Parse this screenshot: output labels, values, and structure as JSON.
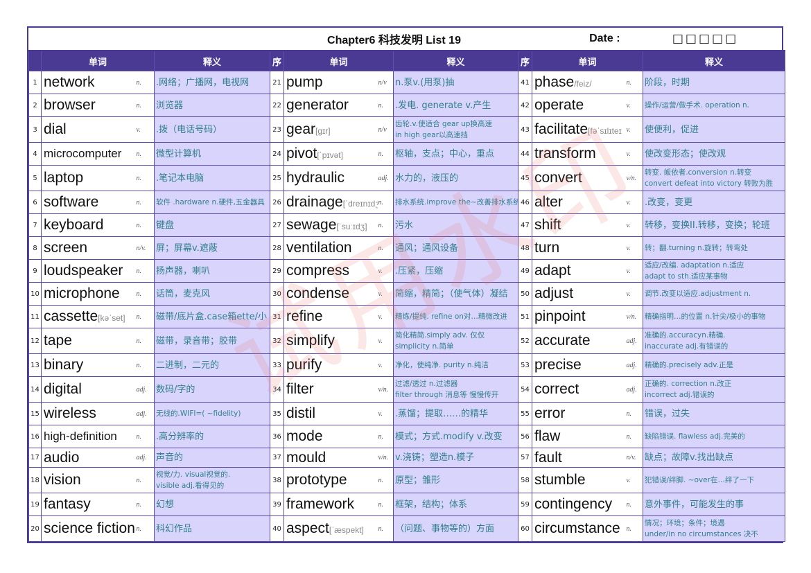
{
  "title": "Chapter6 科技发明 List 19",
  "date_label": "Date :",
  "date_boxes": "□□□□□",
  "headers": {
    "num": "序",
    "word": "单词",
    "meaning": "释义"
  },
  "watermark": "试用水印",
  "columns": [
    {
      "rows": [
        {
          "n": "1",
          "word": "network",
          "phon": "",
          "pos": "n.",
          "meaning": ".网络；广播网，电视网"
        },
        {
          "n": "2",
          "word": "browser",
          "phon": "",
          "pos": "n.",
          "meaning": "浏览器"
        },
        {
          "n": "3",
          "word": "dial",
          "phon": "",
          "pos": "v.",
          "meaning": ".拨（电话号码）"
        },
        {
          "n": "4",
          "word": "microcomputer",
          "phon": "",
          "pos": "n.",
          "meaning": "微型计算机"
        },
        {
          "n": "5",
          "word": "laptop",
          "phon": "",
          "pos": "n.",
          "meaning": ".笔记本电脑"
        },
        {
          "n": "6",
          "word": "software",
          "phon": "",
          "pos": "n.",
          "meaning": "软件 .hardware n.硬件,五金器具"
        },
        {
          "n": "7",
          "word": "keyboard",
          "phon": "",
          "pos": "n.",
          "meaning": "键盘"
        },
        {
          "n": "8",
          "word": "screen",
          "phon": "",
          "pos": "n/v.",
          "meaning": "屏；屏幕v.遮蔽"
        },
        {
          "n": "9",
          "word": "loudspeaker",
          "phon": "",
          "pos": "n.",
          "meaning": "扬声器，喇叭"
        },
        {
          "n": "10",
          "word": "microphone",
          "phon": "",
          "pos": "n.",
          "meaning": "话筒，麦克风"
        },
        {
          "n": "11",
          "word": "cassette",
          "phon": "[kəˈset]",
          "pos": "n.",
          "meaning": "磁带/底片盒.case箱ette/小"
        },
        {
          "n": "12",
          "word": "tape",
          "phon": "",
          "pos": "n.",
          "meaning": "磁带，录音带；胶带"
        },
        {
          "n": "13",
          "word": "binary",
          "phon": "",
          "pos": "n.",
          "meaning": "二进制，二元的"
        },
        {
          "n": "14",
          "word": "digital",
          "phon": "",
          "pos": "adj.",
          "meaning": "数码/字的"
        },
        {
          "n": "15",
          "word": "wireless",
          "phon": "",
          "pos": "adj.",
          "meaning": "无线的.WIFI=( ~fidelity)"
        },
        {
          "n": "16",
          "word": "high-definition",
          "phon": "",
          "pos": "n.",
          "meaning": ".高分辨率的"
        },
        {
          "n": "17",
          "word": "audio",
          "phon": "",
          "pos": "adj.",
          "meaning": "声音的"
        },
        {
          "n": "18",
          "word": "vision",
          "phon": "",
          "pos": "n.",
          "meaning": "视觉/力. visual视觉的.",
          "meaning2": "visible adj.看得见的"
        },
        {
          "n": "19",
          "word": "fantasy",
          "phon": "",
          "pos": "n.",
          "meaning": "幻想"
        },
        {
          "n": "20",
          "word": "science fiction",
          "phon": "",
          "pos": "n.",
          "meaning": "科幻作品"
        }
      ]
    },
    {
      "rows": [
        {
          "n": "21",
          "word": "pump",
          "phon": "",
          "pos": "n/v",
          "meaning": "n.泵v.(用泵)抽"
        },
        {
          "n": "22",
          "word": "generator",
          "phon": "",
          "pos": "n.",
          "meaning": ".发电. generate v.产生"
        },
        {
          "n": "23",
          "word": "gear",
          "phon": "[gɪr]",
          "pos": "n/v",
          "meaning": "齿轮.v.使适合  gear up换高速",
          "meaning2": "in high gear以高速挡"
        },
        {
          "n": "24",
          "word": "pivot",
          "phon": "[ˈpɪvət]",
          "pos": "n.",
          "meaning": "枢轴，支点；中心，重点"
        },
        {
          "n": "25",
          "word": "hydraulic",
          "phon": "",
          "pos": "adj.",
          "meaning": "水力的，液压的"
        },
        {
          "n": "26",
          "word": "drainage",
          "phon": "[ˈdreɪnɪdʒ",
          "pos": "n.",
          "meaning": "排水系统.improve the~改善排水系统"
        },
        {
          "n": "27",
          "word": "sewage",
          "phon": "[ˈsuːɪdʒ]",
          "pos": "n.",
          "meaning": "污水"
        },
        {
          "n": "28",
          "word": "ventilation",
          "phon": "",
          "pos": "n.",
          "meaning": "通风；通风设备"
        },
        {
          "n": "29",
          "word": "compress",
          "phon": "",
          "pos": "v.",
          "meaning": ".压紧，压缩"
        },
        {
          "n": "30",
          "word": "condense",
          "phon": "",
          "pos": "v.",
          "meaning": "简缩，精简；（使气体）凝结"
        },
        {
          "n": "31",
          "word": "refine",
          "phon": "",
          "pos": "v.",
          "meaning": "精炼/提纯. refine on对…精微改进"
        },
        {
          "n": "32",
          "word": "simplify",
          "phon": "",
          "pos": "v.",
          "meaning": "简化精简.simply adv. 仅仅",
          "meaning2": "simplicity n.简单"
        },
        {
          "n": "33",
          "word": "purify",
          "phon": "",
          "pos": "v.",
          "meaning": "净化，使纯净. purity n.纯洁"
        },
        {
          "n": "34",
          "word": "filter",
          "phon": "",
          "pos": "v/n.",
          "meaning": "过滤/透过 n.过滤器",
          "meaning2": "filter through 消息等 慢慢传开"
        },
        {
          "n": "35",
          "word": "distil",
          "phon": "",
          "pos": "v.",
          "meaning": ".蒸馏；提取……的精华"
        },
        {
          "n": "36",
          "word": "mode",
          "phon": "",
          "pos": "n.",
          "meaning": "模式；方式.modify v.改变"
        },
        {
          "n": "37",
          "word": "mould",
          "phon": "",
          "pos": "v/n.",
          "meaning": " v.浇铸；塑造n.模子"
        },
        {
          "n": "38",
          "word": "prototype",
          "phon": "",
          "pos": "n.",
          "meaning": "原型；雏形"
        },
        {
          "n": "39",
          "word": "framework",
          "phon": "",
          "pos": "n.",
          "meaning": "框架，结构；体系"
        },
        {
          "n": "40",
          "word": "aspect",
          "phon": "[ˈæspekt]",
          "pos": "n.",
          "meaning": "（问题、事物等的）方面"
        }
      ]
    },
    {
      "rows": [
        {
          "n": "41",
          "word": "phase",
          "phon": "/feiz/",
          "pos": "n.",
          "meaning": "阶段，时期"
        },
        {
          "n": "42",
          "word": "operate",
          "phon": "",
          "pos": "v.",
          "meaning": "操作/运营/做手术. operation n."
        },
        {
          "n": "43",
          "word": "facilitate",
          "phon": "[fəˈsɪlɪteɪ",
          "pos": "v.",
          "meaning": "使便利，促进"
        },
        {
          "n": "44",
          "word": "transform",
          "phon": "",
          "pos": "v.",
          "meaning": "使改变形态；使改观"
        },
        {
          "n": "45",
          "word": "convert",
          "phon": "",
          "pos": "v/n.",
          "meaning": "转变. 皈依者.conversion n.转变",
          "meaning2": "convert defeat into victory 转败为胜"
        },
        {
          "n": "46",
          "word": "alter",
          "phon": "",
          "pos": "v.",
          "meaning": ".改变，变更"
        },
        {
          "n": "47",
          "word": "shift",
          "phon": "",
          "pos": "v.",
          "meaning": "转移，变换II.转移，变换；轮班"
        },
        {
          "n": "48",
          "word": "turn",
          "phon": "",
          "pos": "v.",
          "meaning": "转；翻.turning n.旋转；转弯处"
        },
        {
          "n": "49",
          "word": "adapt",
          "phon": "",
          "pos": "v.",
          "meaning": "适应/改编. adaptation n.适应",
          "meaning2": "adapt to sth.适应某事物"
        },
        {
          "n": "50",
          "word": "adjust",
          "phon": "",
          "pos": "v.",
          "meaning": "调节.改变以适应.adjustment n."
        },
        {
          "n": "51",
          "word": "pinpoint",
          "phon": "",
          "pos": "v/n.",
          "meaning": "精确指明…的位置 n.针尖/极小的事物"
        },
        {
          "n": "52",
          "word": "accurate",
          "phon": "",
          "pos": "adj.",
          "meaning": "准确的.accuracyn.精确.",
          "meaning2": "inaccurate adj.有错误的"
        },
        {
          "n": "53",
          "word": "precise",
          "phon": "",
          "pos": "adj.",
          "meaning": "精确的.precisely adv.正是"
        },
        {
          "n": "54",
          "word": "correct",
          "phon": "",
          "pos": "adj.",
          "meaning": "正确的. correction n.改正",
          "meaning2": " incorrect adj.错误的"
        },
        {
          "n": "55",
          "word": "error",
          "phon": "",
          "pos": "n.",
          "meaning": "错误，过失"
        },
        {
          "n": "56",
          "word": "flaw",
          "phon": "",
          "pos": "n.",
          "meaning": "缺陷错误. flawless adj.完美的"
        },
        {
          "n": "57",
          "word": "fault",
          "phon": "",
          "pos": "n/v.",
          "meaning": "缺点；故障v.找出缺点"
        },
        {
          "n": "58",
          "word": "stumble",
          "phon": "",
          "pos": "v.",
          "meaning": "犯错误/绊脚. ~over在…绊了一下"
        },
        {
          "n": "59",
          "word": "contingency",
          "phon": "",
          "pos": "n.",
          "meaning": "意外事件，可能发生的事"
        },
        {
          "n": "60",
          "word": "circumstance",
          "phon": "",
          "pos": "n.",
          "meaning": "情况；环境；条件；境遇",
          "meaning2": "under/in no circumstances 决不"
        }
      ]
    }
  ]
}
